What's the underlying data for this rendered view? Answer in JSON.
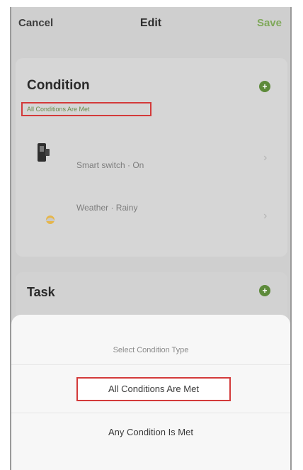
{
  "topbar": {
    "cancel": "Cancel",
    "title": "Edit",
    "save": "Save"
  },
  "condition": {
    "title": "Condition",
    "subtitle": "All Conditions Are Met",
    "add_symbol": "+",
    "items": [
      {
        "icon": "device-icon",
        "label": "Smart switch · On"
      },
      {
        "icon": "weather-icon",
        "label": "Weather · Rainy"
      }
    ],
    "chevron": "›"
  },
  "task": {
    "title": "Task",
    "add_symbol": "+"
  },
  "sheet": {
    "title": "Select Condition Type",
    "option_all": "All Conditions Are Met",
    "option_any": "Any Condition Is Met"
  },
  "colors": {
    "accent_green": "#5d8a3a",
    "highlight_red": "#d33a3a",
    "overlay_gray": "#cfcfcf"
  }
}
